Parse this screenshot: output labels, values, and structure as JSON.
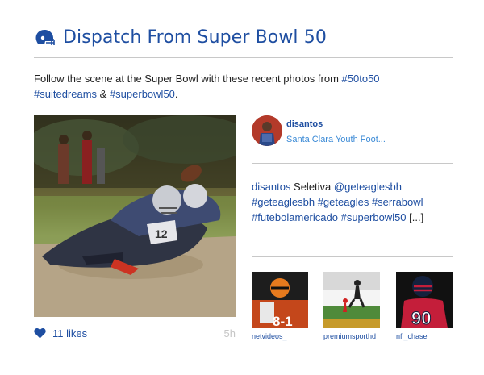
{
  "header": {
    "icon": "football-helmet-icon",
    "title": "Dispatch From Super Bowl 50"
  },
  "intro": {
    "text_before": "Follow the scene at the Super Bowl with these recent photos from ",
    "tag1": "#50to50",
    "tag2": "#suitedreams",
    "amp": " & ",
    "tag3": "#superbowl50",
    "text_after": "."
  },
  "featured": {
    "image": "photo of a flag-football tackle on a dirt field",
    "likes_icon": "heart-icon",
    "likes": "11 likes",
    "age": "5h",
    "username": "disantos",
    "location": "Santa Clara Youth Foot...",
    "caption": {
      "user": "disantos",
      "word": " Seletiva ",
      "tags": [
        "@geteaglesbh",
        "#geteaglesbh",
        "#geteagles",
        "#serrabowl",
        "#futebolamericado",
        "#superbowl50"
      ],
      "more": "[...]"
    }
  },
  "thumbnails": [
    {
      "user": "netvideos_",
      "overlay": "8-1"
    },
    {
      "user": "premiumsporthd"
    },
    {
      "user": "nfl_chase",
      "overlay": "90"
    }
  ],
  "colors": {
    "accent": "#1e4ea1",
    "link_light": "#3b8ad6",
    "rule": "#c8c8c8",
    "muted": "#c6c6c6"
  }
}
